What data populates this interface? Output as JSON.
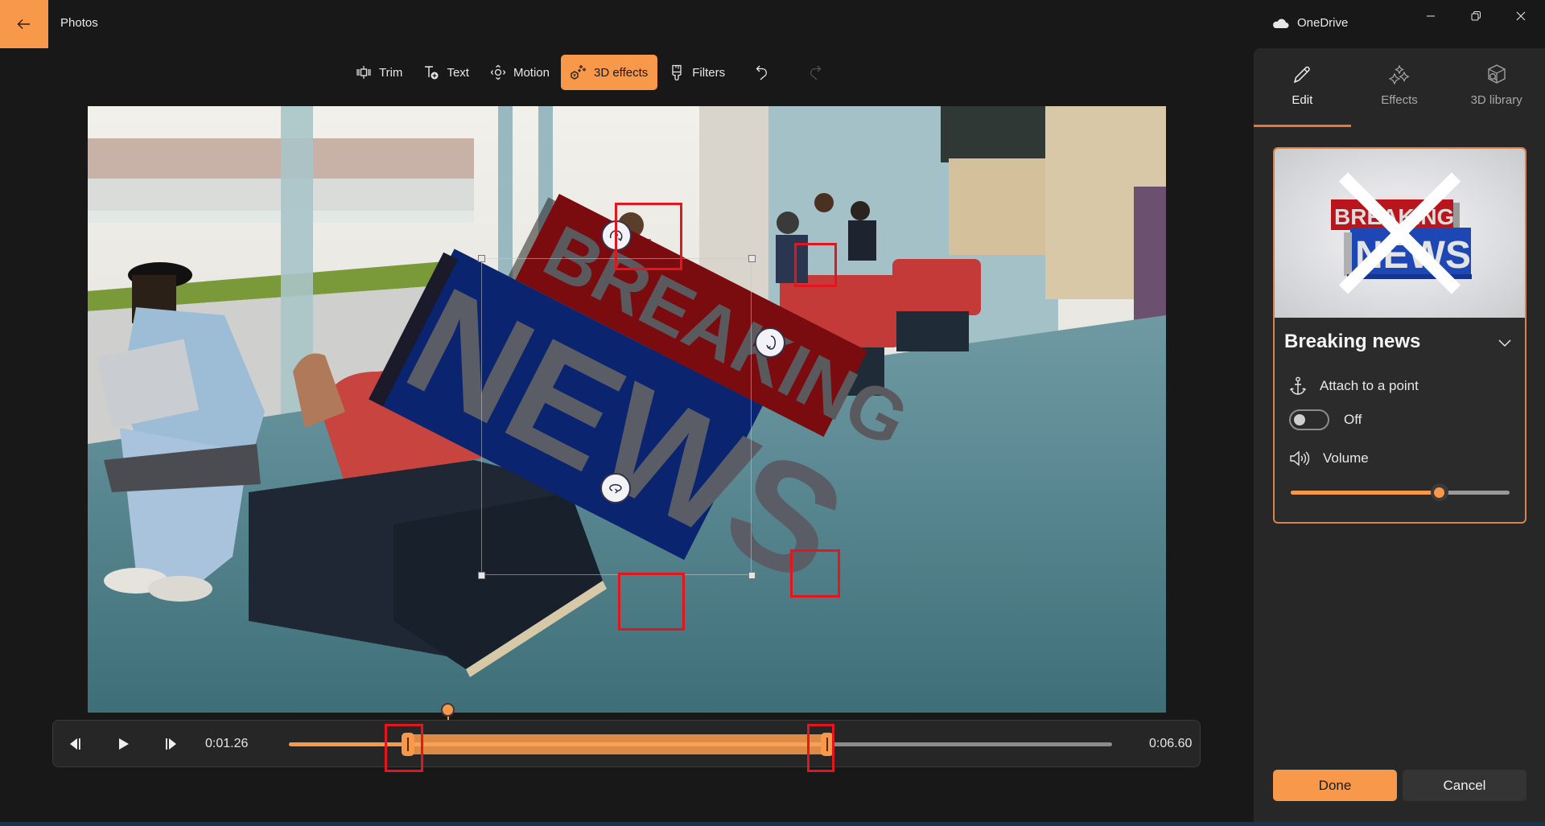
{
  "window": {
    "app_title": "Photos",
    "onedrive_label": "OneDrive",
    "accent": "#f7984a"
  },
  "toolbar": {
    "items": [
      {
        "label": "Trim",
        "icon": "trim-icon"
      },
      {
        "label": "Text",
        "icon": "text-add-icon"
      },
      {
        "label": "Motion",
        "icon": "motion-icon"
      },
      {
        "label": "3D effects",
        "icon": "3d-effects-icon",
        "active": true
      },
      {
        "label": "Filters",
        "icon": "filters-brush-icon"
      }
    ],
    "undo_icon": "undo-icon",
    "redo_icon": "redo-icon",
    "redo_enabled": false
  },
  "canvas": {
    "overlay_effect": {
      "line1": "BREAKING",
      "line2": "NEWS"
    }
  },
  "playback": {
    "current_time": "0:01.26",
    "end_time": "0:06.60",
    "clip_start_fraction": 0.18,
    "clip_end_fraction": 0.65,
    "playhead_fraction": 0.197
  },
  "panel": {
    "tabs": [
      {
        "label": "Edit",
        "icon": "pencil-icon",
        "active": true
      },
      {
        "label": "Effects",
        "icon": "sparkles-icon",
        "active": false
      },
      {
        "label": "3D library",
        "icon": "cube-search-icon",
        "active": false
      }
    ],
    "effect_card": {
      "title": "Breaking news",
      "thumb_line1": "BREAKING",
      "thumb_line2": "NEWS",
      "attach_label": "Attach to a point",
      "attach_toggle_state": "Off",
      "volume_label": "Volume",
      "volume_percent": 68
    },
    "done_label": "Done",
    "cancel_label": "Cancel"
  }
}
